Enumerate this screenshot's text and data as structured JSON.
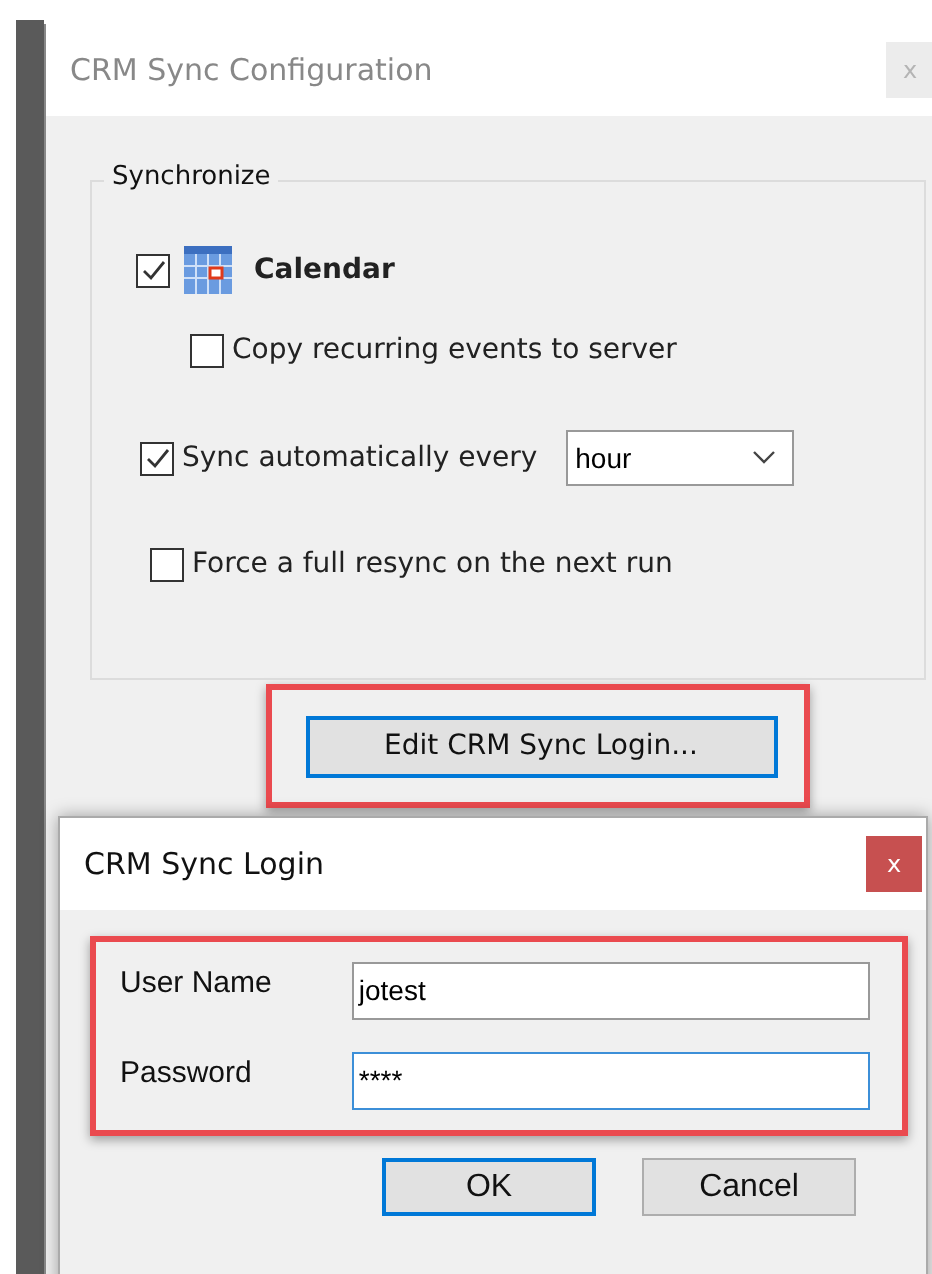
{
  "main_window": {
    "title": "CRM Sync Configuration",
    "active": false,
    "close": "x",
    "group": {
      "title": "Synchronize",
      "items": [
        {
          "kind": "feature",
          "label": "Calendar",
          "checked": true,
          "children": [
            {
              "kind": "option",
              "label": "Copy recurring events to server",
              "checked": false
            }
          ]
        },
        {
          "kind": "interval",
          "label": "Sync automatically every",
          "checked": true,
          "value": "hour"
        },
        {
          "kind": "option",
          "label": "Force a full resync on the next run",
          "checked": false
        }
      ]
    },
    "button": {
      "label": "Edit CRM Sync Login...",
      "focused": true,
      "highlighted": true
    }
  },
  "login_dialog": {
    "title": "CRM Sync Login",
    "active": true,
    "close": "x",
    "highlighted": true,
    "fields": [
      {
        "label": "User Name",
        "value": "jotest",
        "focused": false
      },
      {
        "label": "Password",
        "value": "****",
        "focused": true
      }
    ],
    "buttons": [
      {
        "label": "OK",
        "default": true
      },
      {
        "label": "Cancel",
        "default": false
      }
    ]
  }
}
